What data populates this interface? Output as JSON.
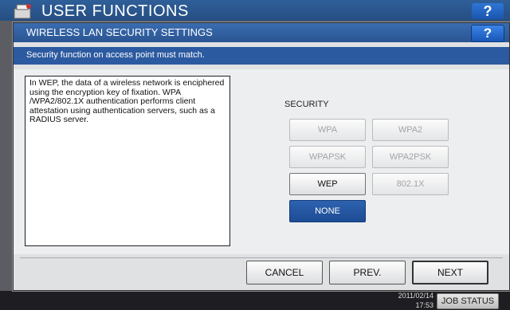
{
  "background": {
    "title": "USER FUNCTIONS",
    "help_label": "?",
    "clock_date": "2011/02/14",
    "clock_time": "17:53",
    "job_status_label": "JOB STATUS"
  },
  "dialog": {
    "title": "WIRELESS LAN SECURITY SETTINGS",
    "help_label": "?",
    "message": "Security function on access point must match.",
    "description": "In WEP, the data of a wireless network is enciphered using the encryption key of fixation. WPA /WPA2/802.1X authentication performs client attestation using authentication servers, such as a RADIUS server.",
    "security_label": "SECURITY",
    "options": {
      "wpa": "WPA",
      "wpa2": "WPA2",
      "wpapsk": "WPAPSK",
      "wpa2psk": "WPA2PSK",
      "wep": "WEP",
      "dot1x": "802.1X",
      "none": "NONE"
    },
    "selected_option": "NONE",
    "buttons": {
      "cancel": "CANCEL",
      "prev": "PREV.",
      "next": "NEXT"
    }
  },
  "colors": {
    "accent_blue": "#2c5aa0",
    "selected_button": "#1d4c93",
    "panel_bg": "#eceef0"
  }
}
